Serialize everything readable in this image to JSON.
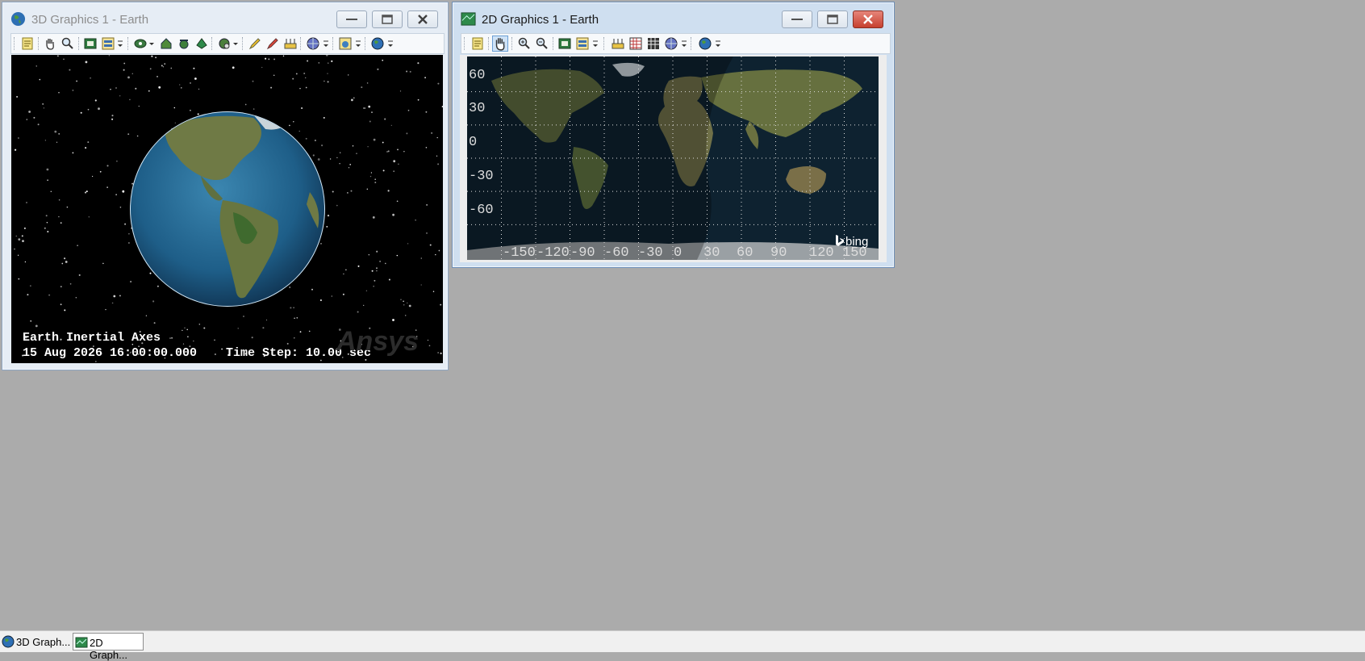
{
  "windows": {
    "graphics3d": {
      "title": "3D Graphics 1 - Earth",
      "overlay": {
        "axes_label": "Earth Inertial Axes",
        "datetime": "15 Aug 2026 16:00:00.000",
        "time_step": "Time Step: 10.00 sec",
        "watermark": "Ansys"
      }
    },
    "graphics2d": {
      "title": "2D Graphics 1 - Earth",
      "map": {
        "lat_labels": [
          "60",
          "30",
          "0",
          "-30",
          "-60"
        ],
        "lon_labels": [
          "-150",
          "-120",
          "-90",
          "-60",
          "-30",
          "0",
          "30",
          "60",
          "90",
          "120",
          "150"
        ],
        "attribution": "bing"
      }
    }
  },
  "taskbar": {
    "items": [
      {
        "label": "3D Graph...",
        "icon": "globe-icon"
      },
      {
        "label": "2D Graph...",
        "icon": "map-icon"
      }
    ]
  },
  "colors": {
    "mdi_background": "#ababab",
    "close_button_active": "#c6402f",
    "space_background": "#000000"
  }
}
